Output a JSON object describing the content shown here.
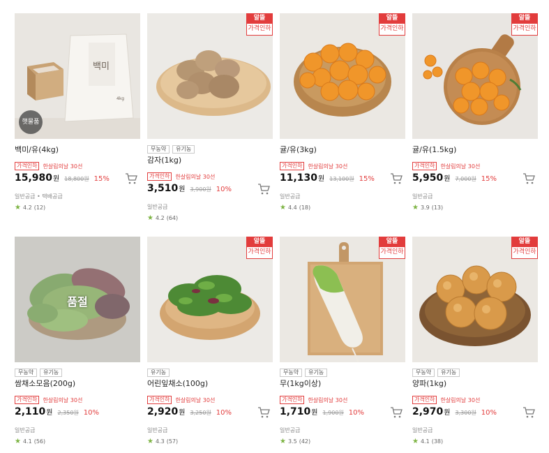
{
  "products": [
    {
      "name": "백미/유(4kg)",
      "tags": [],
      "badge": {
        "top": "",
        "bottom": ""
      },
      "new_label": "햇물품",
      "soldout_label": "",
      "promo_chip": "가격인하",
      "promo_text": "한살림의날 30선",
      "price": "15,980",
      "won": "원",
      "orig_price": "18,800원",
      "discount": "15%",
      "shipping": "일반공급 • 택배공급",
      "rating": "4.2",
      "reviews": "(12)"
    },
    {
      "name": "감자(1kg)",
      "tags": [
        "무농약",
        "유기농"
      ],
      "badge": {
        "top": "알뜰",
        "bottom": "가격인하"
      },
      "new_label": "",
      "soldout_label": "",
      "promo_chip": "가격인하",
      "promo_text": "한살림의날 30선",
      "price": "3,510",
      "won": "원",
      "orig_price": "3,900원",
      "discount": "10%",
      "shipping": "일반공급",
      "rating": "4.2",
      "reviews": "(64)"
    },
    {
      "name": "귤/유(3kg)",
      "tags": [],
      "badge": {
        "top": "알뜰",
        "bottom": "가격인하"
      },
      "new_label": "",
      "soldout_label": "",
      "promo_chip": "가격인하",
      "promo_text": "한살림의날 30선",
      "price": "11,130",
      "won": "원",
      "orig_price": "13,100원",
      "discount": "15%",
      "shipping": "일반공급",
      "rating": "4.4",
      "reviews": "(18)"
    },
    {
      "name": "귤/유(1.5kg)",
      "tags": [],
      "badge": {
        "top": "알뜰",
        "bottom": "가격인하"
      },
      "new_label": "",
      "soldout_label": "",
      "promo_chip": "가격인하",
      "promo_text": "한살림의날 30선",
      "price": "5,950",
      "won": "원",
      "orig_price": "7,000원",
      "discount": "15%",
      "shipping": "일반공급",
      "rating": "3.9",
      "reviews": "(13)"
    },
    {
      "name": "쌈채소모음(200g)",
      "tags": [
        "무농약",
        "유기농"
      ],
      "badge": {
        "top": "",
        "bottom": ""
      },
      "new_label": "",
      "soldout_label": "품절",
      "promo_chip": "가격인하",
      "promo_text": "한살림의날 30선",
      "price": "2,110",
      "won": "원",
      "orig_price": "2,350원",
      "discount": "10%",
      "shipping": "일반공급",
      "rating": "4.1",
      "reviews": "(56)"
    },
    {
      "name": "어린잎채소(100g)",
      "tags": [
        "유기농"
      ],
      "badge": {
        "top": "알뜰",
        "bottom": "가격인하"
      },
      "new_label": "",
      "soldout_label": "",
      "promo_chip": "가격인하",
      "promo_text": "한살림의날 30선",
      "price": "2,920",
      "won": "원",
      "orig_price": "3,250원",
      "discount": "10%",
      "shipping": "일반공급",
      "rating": "4.3",
      "reviews": "(57)"
    },
    {
      "name": "무(1kg이상)",
      "tags": [
        "무농약",
        "유기농"
      ],
      "badge": {
        "top": "알뜰",
        "bottom": "가격인하"
      },
      "new_label": "",
      "soldout_label": "",
      "promo_chip": "가격인하",
      "promo_text": "한살림의날 30선",
      "price": "1,710",
      "won": "원",
      "orig_price": "1,900원",
      "discount": "10%",
      "shipping": "일반공급",
      "rating": "3.5",
      "reviews": "(42)"
    },
    {
      "name": "양파(1kg)",
      "tags": [
        "무농약",
        "유기농"
      ],
      "badge": {
        "top": "알뜰",
        "bottom": "가격인하"
      },
      "new_label": "",
      "soldout_label": "",
      "promo_chip": "가격인하",
      "promo_text": "한살림의날 30선",
      "price": "2,970",
      "won": "원",
      "orig_price": "3,300원",
      "discount": "10%",
      "shipping": "일반공급",
      "rating": "4.1",
      "reviews": "(38)"
    }
  ],
  "rice_bag_label": "백미",
  "rice_bag_weight": "4kg",
  "colors": {
    "accent": "#e23c3c",
    "star": "#7cb342"
  },
  "icons": {
    "cart": "cart-icon",
    "star": "star-icon"
  }
}
